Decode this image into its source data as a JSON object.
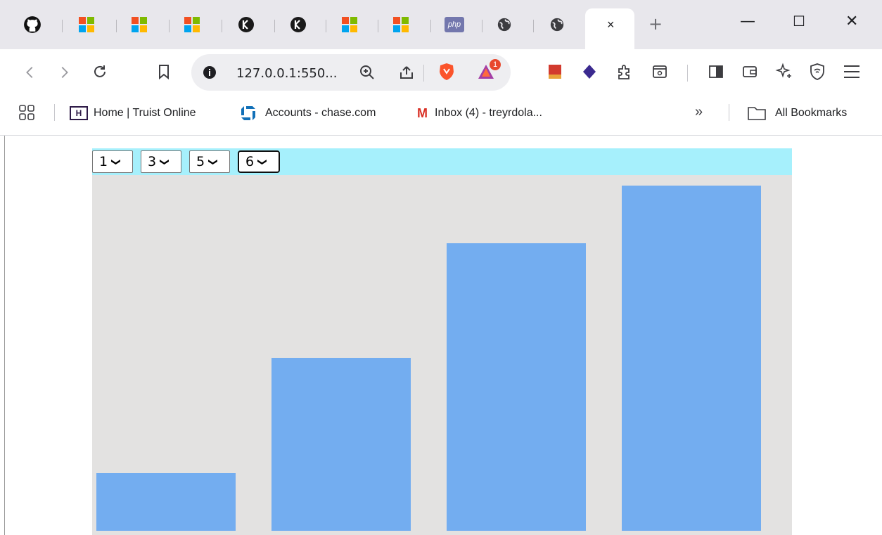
{
  "browser": {
    "tabs": [
      {
        "icon": "github-icon"
      },
      {
        "icon": "microsoft-icon"
      },
      {
        "icon": "microsoft-icon"
      },
      {
        "icon": "microsoft-icon"
      },
      {
        "icon": "k-icon"
      },
      {
        "icon": "k-icon"
      },
      {
        "icon": "microsoft-icon"
      },
      {
        "icon": "microsoft-icon"
      },
      {
        "icon": "php-icon",
        "label": "php"
      },
      {
        "icon": "globe-icon"
      },
      {
        "icon": "globe-icon"
      }
    ],
    "active_tab_close": "×",
    "new_tab": "+",
    "window": {
      "minimize": "—",
      "maximize": "☐",
      "close": "✕"
    },
    "address": {
      "url": "127.0.0.1:550..."
    },
    "bookmarks": [
      {
        "label": "Home | Truist Online",
        "icon": "truist-icon",
        "icon_text": "H"
      },
      {
        "label": "Accounts - chase.com",
        "icon": "chase-icon"
      },
      {
        "label": "Inbox (4) - treyrdola...",
        "icon": "gmail-icon",
        "icon_text": "M"
      }
    ],
    "bookmarks_overflow": "»",
    "all_bookmarks": "All Bookmarks",
    "brave_badge": "1",
    "colors": {
      "tab_strip": "#e8e7ec",
      "omnibox": "#eeeef1"
    }
  },
  "page": {
    "selects": [
      {
        "value": "1"
      },
      {
        "value": "3"
      },
      {
        "value": "5"
      },
      {
        "value": "6",
        "focused": true
      }
    ],
    "colors": {
      "topbar": "#a6f0fc",
      "chart_bg": "#e3e2e1",
      "bar": "#73adf0"
    }
  },
  "chart_data": {
    "type": "bar",
    "categories": [
      "1",
      "3",
      "5",
      "6"
    ],
    "values": [
      1,
      3,
      5,
      6
    ],
    "ylim": [
      0,
      6
    ]
  }
}
